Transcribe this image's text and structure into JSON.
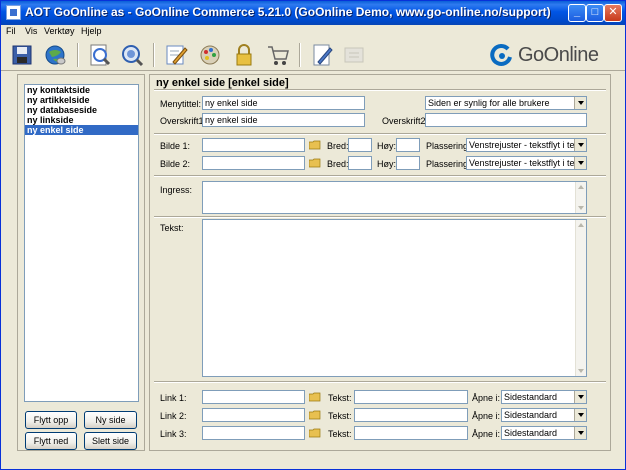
{
  "window": {
    "title": "AOT GoOnline as - GoOnline Commerce 5.21.0 (GoOnline Demo, www.go-online.no/support)"
  },
  "menu": [
    "Fil",
    "Vis",
    "Verktøy",
    "Hjelp"
  ],
  "toolbar": {
    "icons": [
      "save-icon",
      "globe-icon",
      "preview-icon",
      "search-icon",
      "edit-icon",
      "images-icon",
      "lock-icon",
      "cart-icon",
      "notepad-icon",
      "disabled-icon"
    ],
    "brand": "GoOnline",
    "accent": "#0A6BC1"
  },
  "pages": {
    "items": [
      "ny kontaktside",
      "ny artikkelside",
      "ny databaseside",
      "ny linkside",
      "ny enkel side"
    ],
    "selected_index": 4
  },
  "buttons": {
    "move_up": "Flytt opp",
    "new_page": "Ny side",
    "move_down": "Flytt ned",
    "delete_page": "Slett side"
  },
  "form": {
    "heading": "ny enkel side  [enkel side]",
    "menu_title_label": "Menytittel:",
    "menu_title_value": "ny enkel side",
    "visibility_value": "Siden er synlig for alle brukere",
    "heading1_label": "Overskrift1:",
    "heading1_value": "ny enkel side",
    "heading2_label": "Overskrift2:",
    "heading2_value": "",
    "image1_label": "Bilde 1:",
    "image2_label": "Bilde 2:",
    "width_label": "Bred:",
    "height_label": "Høy:",
    "placement_label": "Plassering:",
    "placement1_value": "Venstrejuster - tekstflyt i tekst",
    "placement2_value": "Venstrejuster - tekstflyt i tekst",
    "ingress_label": "Ingress:",
    "text_label": "Tekst:",
    "links": [
      {
        "label": "Link 1:",
        "text_label": "Tekst:",
        "open_label": "Åpne i:",
        "open_value": "Sidestandard"
      },
      {
        "label": "Link 2:",
        "text_label": "Tekst:",
        "open_label": "Åpne i:",
        "open_value": "Sidestandard"
      },
      {
        "label": "Link 3:",
        "text_label": "Tekst:",
        "open_label": "Åpne i:",
        "open_value": "Sidestandard"
      }
    ]
  }
}
